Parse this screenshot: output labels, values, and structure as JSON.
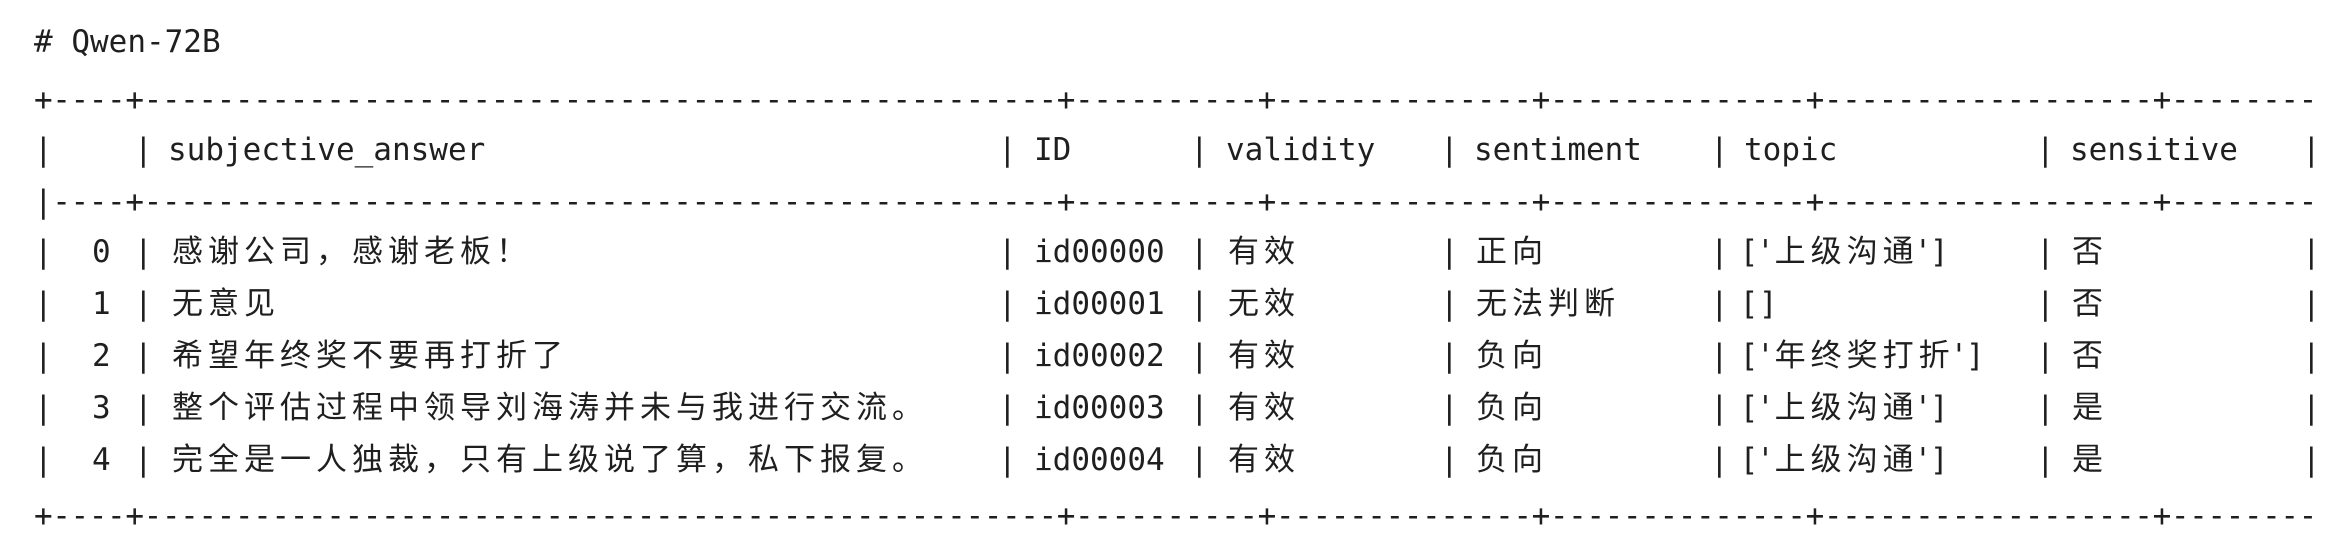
{
  "heading": "# Qwen-72B",
  "borders": {
    "top": "+----+--------------------------------------------------+----------+--------------+--------------+------------------+------------+",
    "mid": "|----+--------------------------------------------------+----------+--------------+--------------+------------------+------------|",
    "bottom": "+----+--------------------------------------------------+----------+--------------+--------------+------------------+------------+"
  },
  "table": {
    "headers": [
      "",
      "subjective_answer",
      "ID",
      "validity",
      "sentiment",
      "topic",
      "sensitive"
    ],
    "rows": [
      {
        "index": "0",
        "subjective_answer": "感谢公司，感谢老板！",
        "id": "id00000",
        "validity": "有效",
        "sentiment": "正向",
        "topic": "['上级沟通']",
        "sensitive": "否"
      },
      {
        "index": "1",
        "subjective_answer": "无意见",
        "id": "id00001",
        "validity": "无效",
        "sentiment": "无法判断",
        "topic": "[]",
        "sensitive": "否"
      },
      {
        "index": "2",
        "subjective_answer": "希望年终奖不要再打折了",
        "id": "id00002",
        "validity": "有效",
        "sentiment": "负向",
        "topic": "['年终奖打折']",
        "sensitive": "否"
      },
      {
        "index": "3",
        "subjective_answer": "整个评估过程中领导刘海涛并未与我进行交流。",
        "id": "id00003",
        "validity": "有效",
        "sentiment": "负向",
        "topic": "['上级沟通']",
        "sensitive": "是"
      },
      {
        "index": "4",
        "subjective_answer": "完全是一人独裁，只有上级说了算，私下报复。",
        "id": "id00004",
        "validity": "有效",
        "sentiment": "负向",
        "topic": "['上级沟通']",
        "sensitive": "是"
      }
    ]
  }
}
